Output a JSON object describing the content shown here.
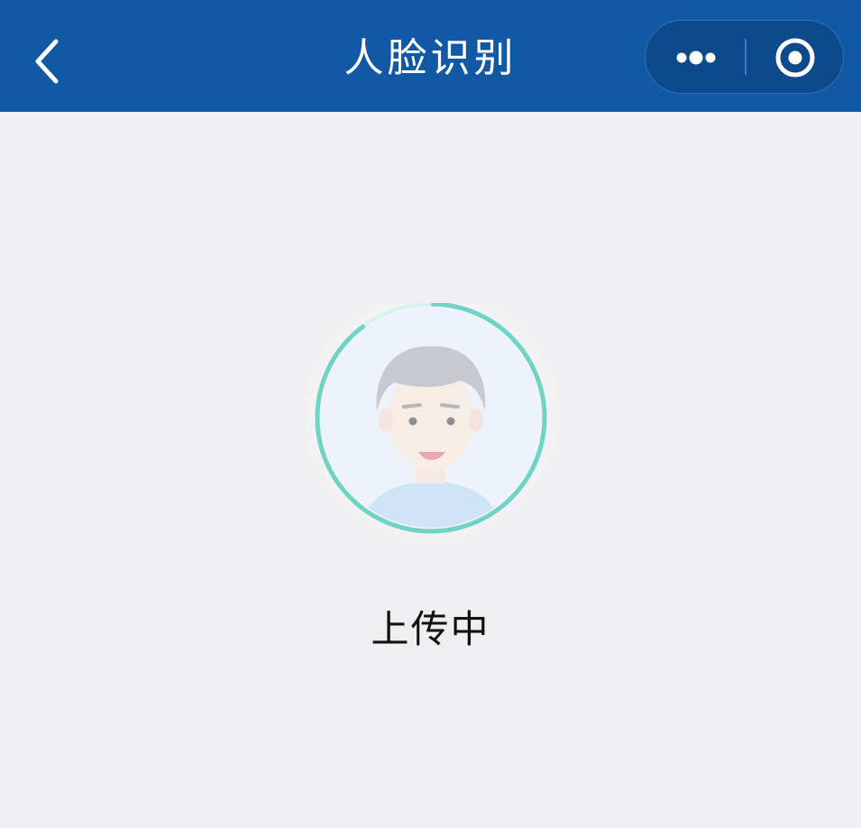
{
  "navbar": {
    "title": "人脸识别",
    "background_color": "#1158a5",
    "back_icon": "chevron-left-icon",
    "more_icon": "more-dots-icon",
    "close_icon": "target-circle-icon"
  },
  "face_scan": {
    "status_text": "上传中",
    "progress": 0.9,
    "ring_color": "#6fd3c7",
    "avatar_icon": "face-avatar-icon"
  }
}
